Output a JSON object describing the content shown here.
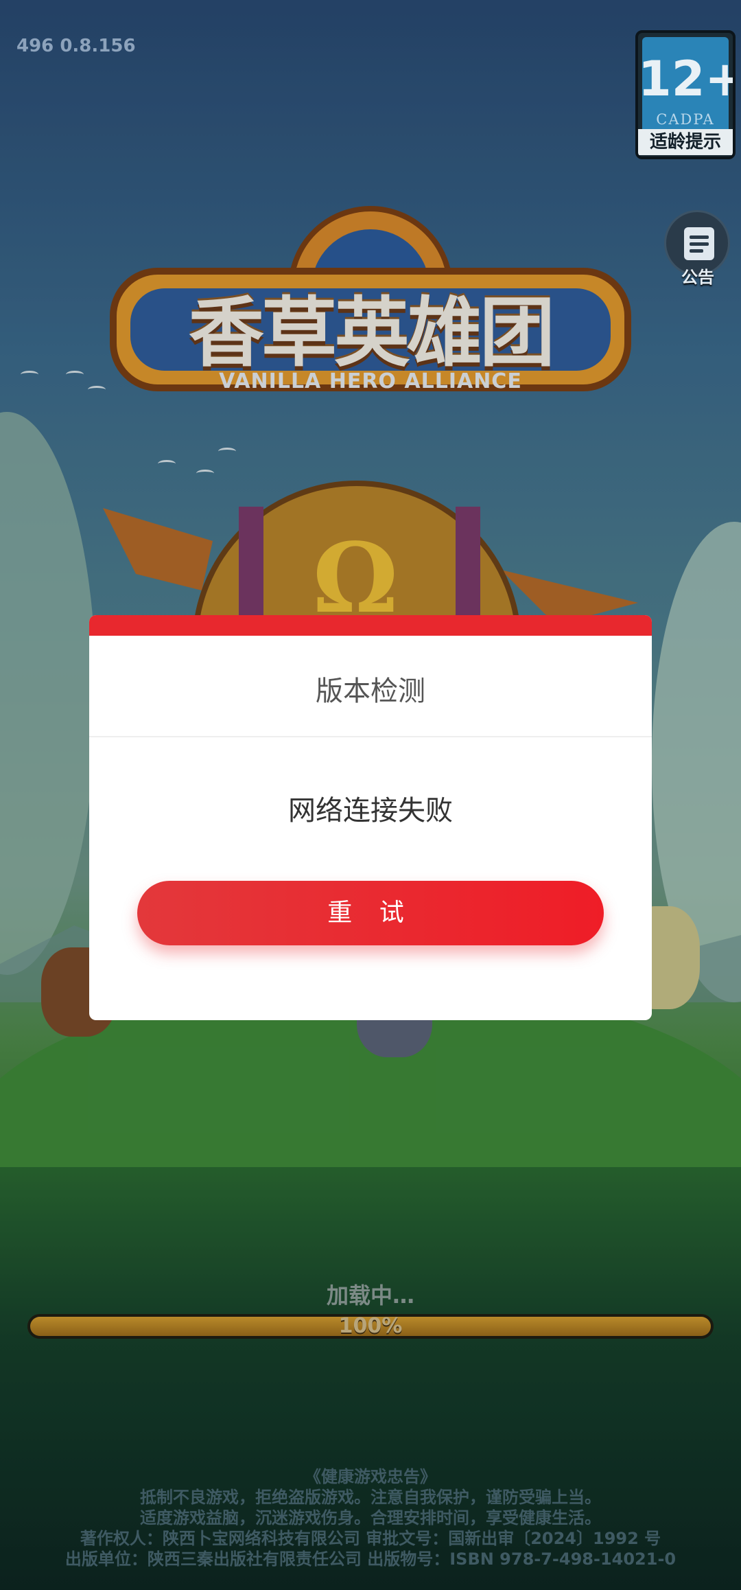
{
  "version": "496 0.8.156",
  "age_rating": {
    "number": "12+",
    "org": "CADPA",
    "label": "适龄提示"
  },
  "notice_button": {
    "icon": "notice-board-icon",
    "label": "公告"
  },
  "logo": {
    "title": "香草英雄团",
    "subtitle": "VANILLA HERO ALLIANCE"
  },
  "dialog": {
    "title": "版本检测",
    "message": "网络连接失败",
    "retry_label": "重 试",
    "accent_color": "#e8282e"
  },
  "loading": {
    "label": "加载中…",
    "progress_text": "100%",
    "progress_value": 1.0
  },
  "footer": {
    "lines": [
      "《健康游戏忠告》",
      "抵制不良游戏，拒绝盗版游戏。注意自我保护，谨防受骗上当。",
      "适度游戏益脑，沉迷游戏伤身。合理安排时间，享受健康生活。",
      "著作权人：陕西卜宝网络科技有限公司 审批文号：国新出审〔2024〕1992 号",
      "出版单位：陕西三秦出版社有限责任公司 出版物号：ISBN 978-7-498-14021-0"
    ]
  }
}
